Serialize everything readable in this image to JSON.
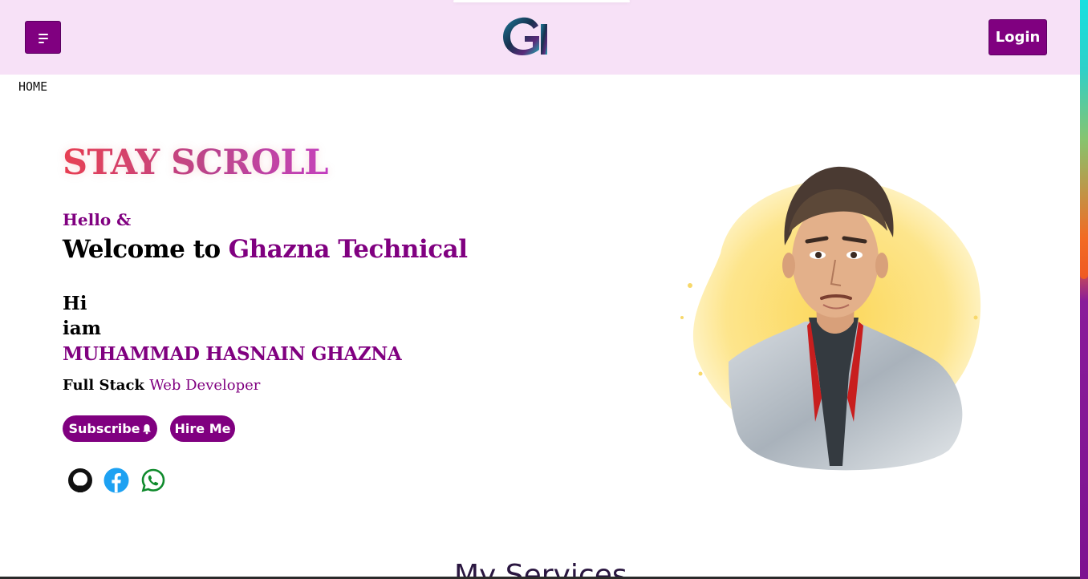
{
  "header": {
    "menu_icon": "hamburger-menu-icon",
    "logo_icon": "g-logo-icon",
    "login_label": "Login"
  },
  "breadcrumb": {
    "label": "HOME"
  },
  "hero": {
    "site_title": "STAY SCROLL",
    "greeting": "Hello &",
    "welcome_prefix": "Welcome to",
    "welcome_brand": "Ghazna Technical",
    "hi": "Hi",
    "iam": "iam",
    "name": "MUHAMMAD HASNAIN GHAZNA",
    "role_prefix": "Full Stack",
    "role_accent": "Web Developer",
    "subscribe_label": "Subscribe",
    "subscribe_icon": "bell-icon",
    "hire_label": "Hire Me"
  },
  "social": [
    {
      "icon": "github-icon",
      "color": "#111111"
    },
    {
      "icon": "facebook-icon",
      "color": "#1da1f2"
    },
    {
      "icon": "whatsapp-icon",
      "color": "#0f8a2c"
    }
  ],
  "section_peek": {
    "title": "My Services"
  },
  "colors": {
    "brand": "#800080",
    "header_bg": "#f7e1f7",
    "title_gradient_start": "#e8394e",
    "title_gradient_end": "#c03ac5"
  }
}
